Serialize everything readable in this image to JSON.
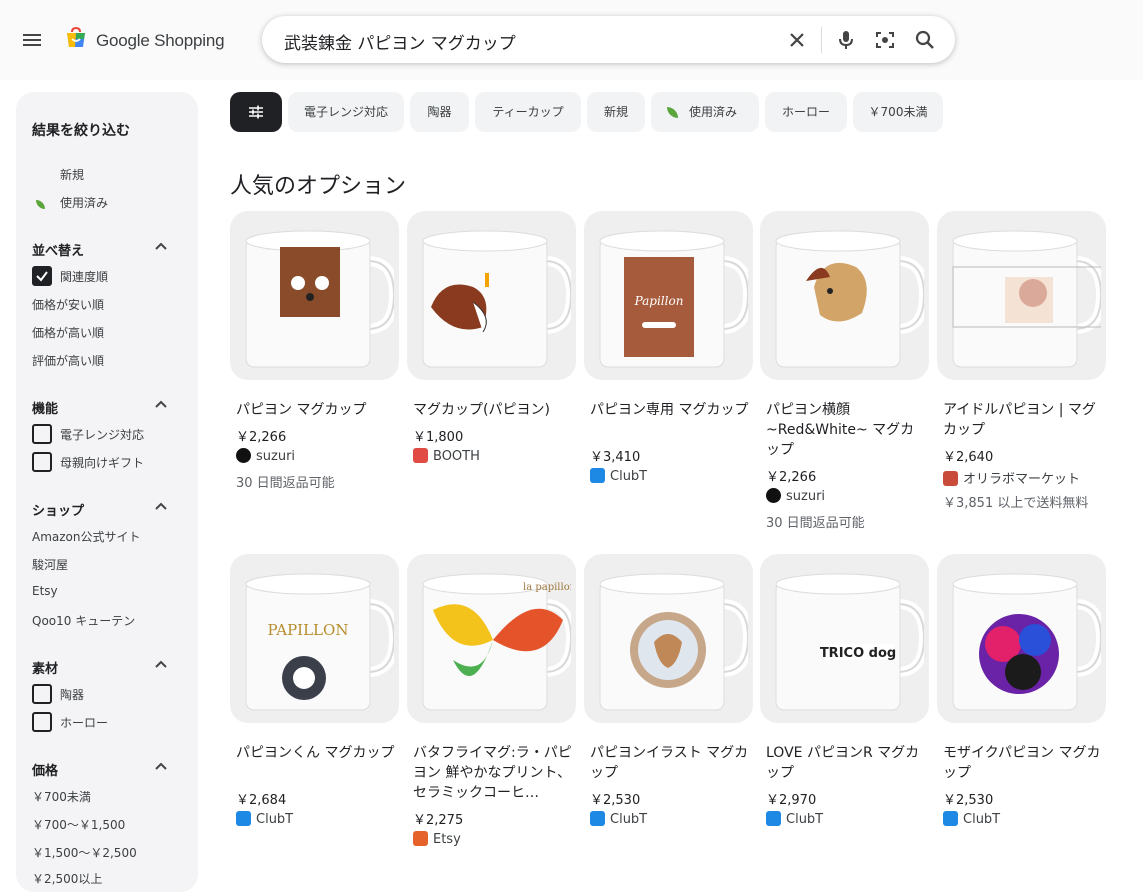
{
  "header": {
    "brand": "Google Shopping",
    "query": "武装錬金 パピヨン マグカップ"
  },
  "sidebar": {
    "title": "結果を絞り込む",
    "condition": [
      "新規",
      "使用済み"
    ],
    "sort": {
      "title": "並べ替え",
      "items": [
        "関連度順",
        "価格が安い順",
        "価格が高い順",
        "評価が高い順"
      ]
    },
    "features": {
      "title": "機能",
      "items": [
        "電子レンジ対応",
        "母親向けギフト"
      ]
    },
    "shops": {
      "title": "ショップ",
      "items": [
        "Amazon公式サイト",
        "駿河屋",
        "Etsy",
        "Qoo10 キューテン"
      ]
    },
    "material": {
      "title": "素材",
      "items": [
        "陶器",
        "ホーロー"
      ]
    },
    "price": {
      "title": "価格",
      "items": [
        "￥700未満",
        "￥700～￥1,500",
        "￥1,500～￥2,500",
        "￥2,500以上"
      ]
    }
  },
  "chips": [
    "電子レンジ対応",
    "陶器",
    "ティーカップ",
    "新規",
    "使用済み",
    "ホーロー",
    "￥700未満"
  ],
  "section_title": "人気のオプション",
  "products": [
    {
      "name": "パピヨン マグカップ",
      "price": "￥2,266",
      "shop": "suzuri",
      "note": "30 日間返品可能",
      "image_text": ""
    },
    {
      "name": "マグカップ(パピヨン)",
      "price": "￥1,800",
      "shop": "BOOTH",
      "note": "",
      "image_text": ""
    },
    {
      "name": "パピヨン専用 マグカップ",
      "price": "￥3,410",
      "shop": "ClubT",
      "note": "",
      "image_text": "Papillon"
    },
    {
      "name": "パピヨン横顔 ~Red&White~ マグカップ",
      "price": "￥2,266",
      "shop": "suzuri",
      "note": "30 日間返品可能",
      "image_text": ""
    },
    {
      "name": "アイドルパピヨン | マグカップ",
      "price": "￥2,640",
      "shop": "オリラボマーケット",
      "note": "￥3,851 以上で送料無料",
      "image_text": ""
    },
    {
      "name": "パピヨンくん マグカップ",
      "price": "￥2,684",
      "shop": "ClubT",
      "note": "",
      "image_text": "PAPILLON"
    },
    {
      "name": "バタフライマグ:ラ・パピヨン 鮮やかなプリント、セラミックコーヒ…",
      "price": "￥2,275",
      "shop": "Etsy",
      "note": "",
      "image_text": "la papillon"
    },
    {
      "name": "パピヨンイラスト マグカップ",
      "price": "￥2,530",
      "shop": "ClubT",
      "note": "",
      "image_text": ""
    },
    {
      "name": "LOVE パピヨンR マグカップ",
      "price": "￥2,970",
      "shop": "ClubT",
      "note": "",
      "image_text": "TRICO dog"
    },
    {
      "name": "モザイクパピヨン マグカップ",
      "price": "￥2,530",
      "shop": "ClubT",
      "note": "",
      "image_text": ""
    }
  ],
  "colors": {
    "accent": "#202124",
    "chip_bg": "#f1f3f4",
    "sidebar_bg": "#f4f4f6",
    "clubt": "#1e88e5",
    "booth": "#e04b44",
    "etsy": "#e5622a",
    "leaf": "#5ba53c"
  },
  "icons": [
    "menu-icon",
    "shopping-bag-logo-icon",
    "clear-icon",
    "mic-icon",
    "lens-icon",
    "search-icon",
    "filter-icon",
    "leaf-icon",
    "chevron-up-icon",
    "checkbox-icon"
  ]
}
